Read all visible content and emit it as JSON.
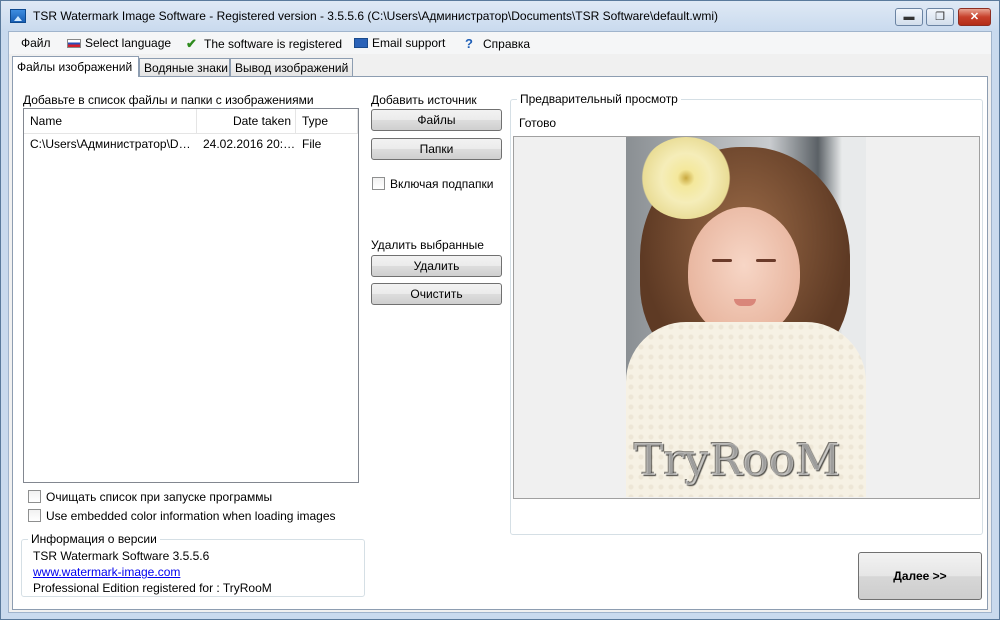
{
  "window": {
    "title": "TSR Watermark Image Software - Registered version - 3.5.5.6 (C:\\Users\\Администратор\\Documents\\TSR Software\\default.wmi)",
    "min_glyph": "▬",
    "max_glyph": "❐",
    "close_glyph": "✕"
  },
  "menu": {
    "file": "Файл",
    "language": "Select language",
    "registered": "The software is registered",
    "email": "Email support",
    "help": "Справка"
  },
  "tabs": [
    "Файлы изображений",
    "Водяные знаки",
    "Вывод изображений"
  ],
  "files": {
    "heading": "Добавьте в список файлы и папки с изображениями",
    "columns": [
      "Name",
      "Date taken",
      "Type"
    ],
    "rows": [
      {
        "name": "C:\\Users\\Администратор\\Dow...",
        "date": "24.02.2016 20:1...",
        "type": "File"
      }
    ]
  },
  "sources": {
    "add_heading": "Добавить источник",
    "files_button": "Файлы",
    "folders_button": "Папки",
    "include_subfolders": "Включая подпапки",
    "remove_heading": "Удалить выбранные",
    "delete_button": "Удалить",
    "clear_button": "Очистить"
  },
  "preview": {
    "heading": "Предварительный просмотр",
    "status": "Готово",
    "watermark_text": "TryRooM"
  },
  "options": {
    "clear_on_start": "Очищать список при запуске программы",
    "embedded_color": "Use embedded color information when loading images"
  },
  "version": {
    "heading": "Информация о версии",
    "product": "TSR Watermark Software 3.5.5.6",
    "website": "www.watermark-image.com",
    "registered_for": "Professional Edition registered for : TryRooM"
  },
  "next_button": "Далее >>",
  "icons": {
    "app": "app-icon",
    "language": "russian-flag-icon",
    "registered": "checkmark-icon",
    "email": "envelope-icon",
    "help": "question-mark-icon"
  }
}
